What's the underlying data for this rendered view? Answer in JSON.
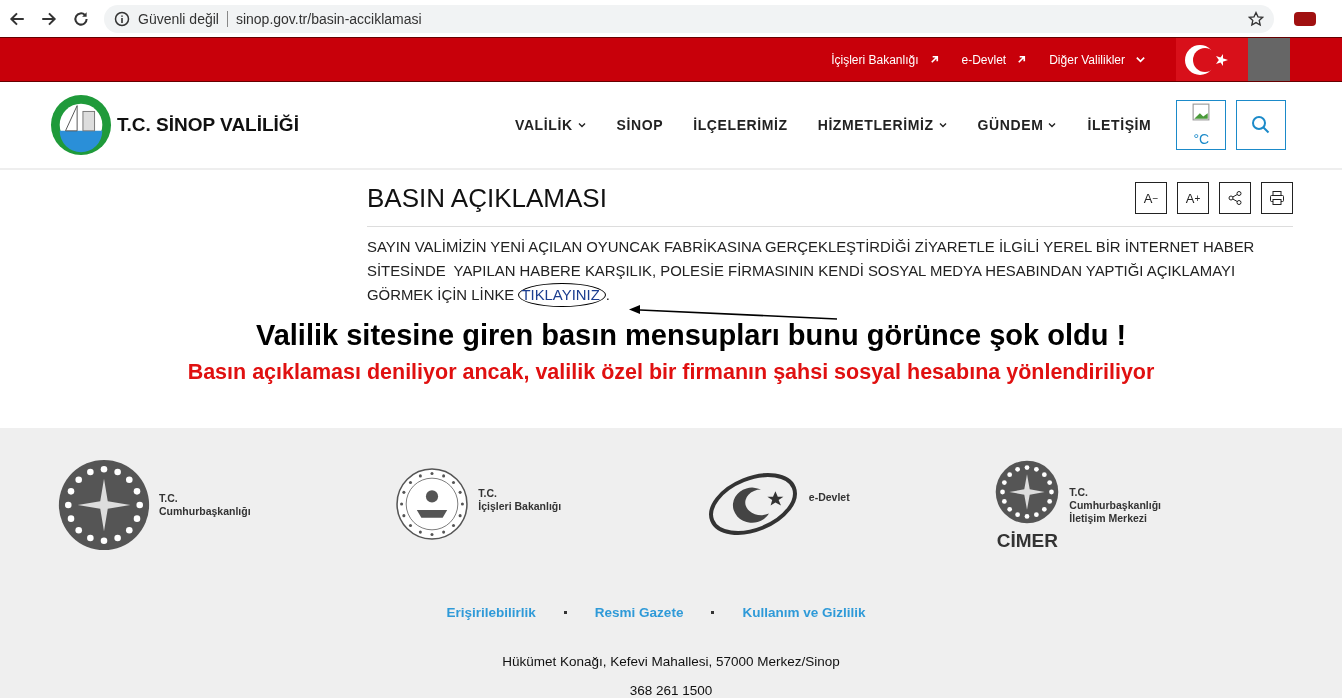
{
  "browser": {
    "security_label": "Güvenli değil",
    "url": "sinop.gov.tr/basin-acciklamasi"
  },
  "top_bar": {
    "links": [
      {
        "label": "İçişleri Bakanlığı",
        "kind": "external"
      },
      {
        "label": "e-Devlet",
        "kind": "external"
      },
      {
        "label": "Diğer Valilikler",
        "kind": "dropdown"
      }
    ]
  },
  "header": {
    "site_title": "T.C. SİNOP VALİLİĞİ",
    "nav": [
      {
        "label": "VALİLİK",
        "dropdown": true
      },
      {
        "label": "SİNOP",
        "dropdown": false
      },
      {
        "label": "İLÇELERİMİZ",
        "dropdown": false
      },
      {
        "label": "HİZMETLERİMİZ",
        "dropdown": true
      },
      {
        "label": "GÜNDEM",
        "dropdown": true
      },
      {
        "label": "İLETİŞİM",
        "dropdown": false
      }
    ],
    "weather_unit": "°C"
  },
  "article": {
    "title": "BASIN AÇIKLAMASI",
    "tools": [
      {
        "label": "A",
        "sup": "−"
      },
      {
        "label": "A",
        "sup": "+"
      }
    ],
    "body_before_link": "SAYIN VALİMİZİN YENİ AÇILAN OYUNCAK FABRİKASINA GERÇEKLEŞTİRDİĞİ ZİYARETLE İLGİLİ YEREL BİR İNTERNET HABER SİTESİNDE  YAPILAN HABERE KARŞILIK, POLESİE FİRMASININ KENDİ SOSYAL MEDYA HESABINDAN YAPTIĞI AÇIKLAMAYI GÖRMEK İÇİN LİNKE ",
    "link": "TIKLAYINIZ",
    "body_after_link": "."
  },
  "annotation": {
    "headline": "Valilik sitesine giren basın mensupları bunu görünce şok oldu !",
    "subheadline": "Basın açıklaması deniliyor ancak, valilik özel bir firmanın şahsi sosyal hesabına yönlendiriliyor"
  },
  "footer": {
    "logos": [
      {
        "kind": "presidency",
        "lines": [
          "T.C.",
          "Cumhurbaşkanlığı"
        ]
      },
      {
        "kind": "ministry",
        "lines": [
          "T.C.",
          "İçişleri Bakanlığı"
        ]
      },
      {
        "kind": "edevlet",
        "lines": [
          "e-Devlet"
        ]
      },
      {
        "kind": "cimer",
        "caption": "CİMER",
        "lines": [
          "T.C.",
          "Cumhurbaşkanlığı",
          "İletişim Merkezi"
        ]
      }
    ],
    "links": [
      "Erişirilebilirlik",
      "Resmi Gazete",
      "Kullanım ve Gizlilik"
    ],
    "address": "Hükümet Konağı, Kefevi Mahallesi, 57000 Merkez/Sinop",
    "phone": "368 261 1500"
  }
}
